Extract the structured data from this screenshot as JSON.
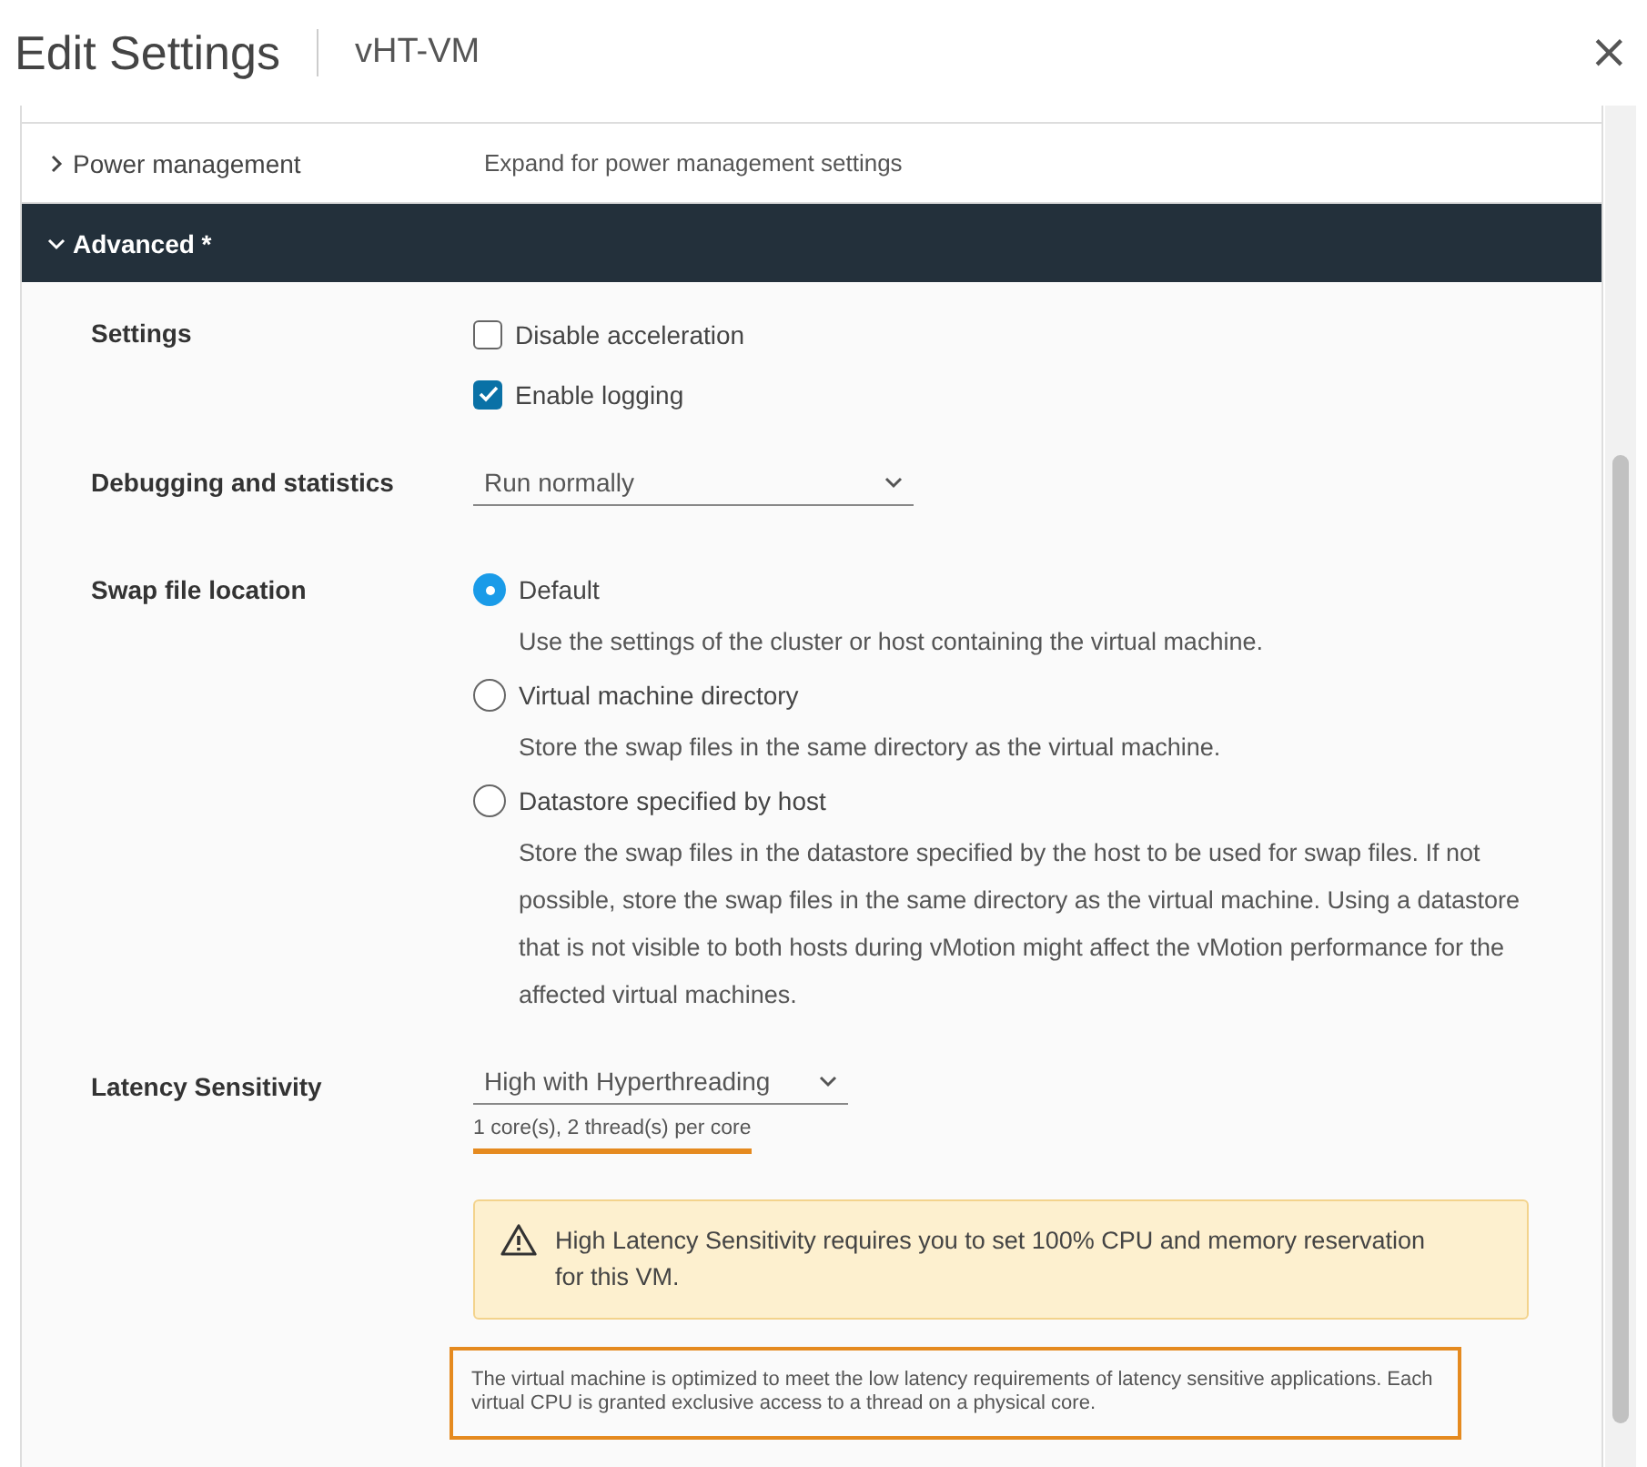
{
  "dialog": {
    "title": "Edit Settings",
    "subtitle": "vHT-VM",
    "close": "×"
  },
  "sections": [
    {
      "label": "Power management",
      "summary": "Expand for power management settings",
      "expanded": false
    },
    {
      "label": "Advanced *",
      "expanded": true
    }
  ],
  "settings": {
    "label": "Settings",
    "options": [
      {
        "label": "Disable acceleration",
        "checked": false
      },
      {
        "label": "Enable logging",
        "checked": true
      }
    ]
  },
  "debugging": {
    "label": "Debugging and statistics",
    "value": "Run normally"
  },
  "swap": {
    "label": "Swap file location",
    "options": [
      {
        "label": "Default",
        "selected": true,
        "description": "Use the settings of the cluster or host containing the virtual machine."
      },
      {
        "label": "Virtual machine directory",
        "selected": false,
        "description": "Store the swap files in the same directory as the virtual machine."
      },
      {
        "label": "Datastore specified by host",
        "selected": false,
        "description": "Store the swap files in the datastore specified by the host to be used for swap files. If not possible, store the swap files in the same directory as the virtual machine. Using a datastore that is not visible to both hosts during vMotion might affect the vMotion performance for the affected virtual machines."
      }
    ]
  },
  "latency": {
    "label": "Latency Sensitivity",
    "value": "High with Hyperthreading",
    "detail": "1 core(s), 2 thread(s) per core",
    "warning": "High Latency Sensitivity requires you to set 100% CPU and memory reservation for this VM.",
    "note": "The virtual machine is optimized to meet the low latency requirements of latency sensitive applications. Each virtual CPU is granted exclusive access to a thread on a physical core."
  }
}
